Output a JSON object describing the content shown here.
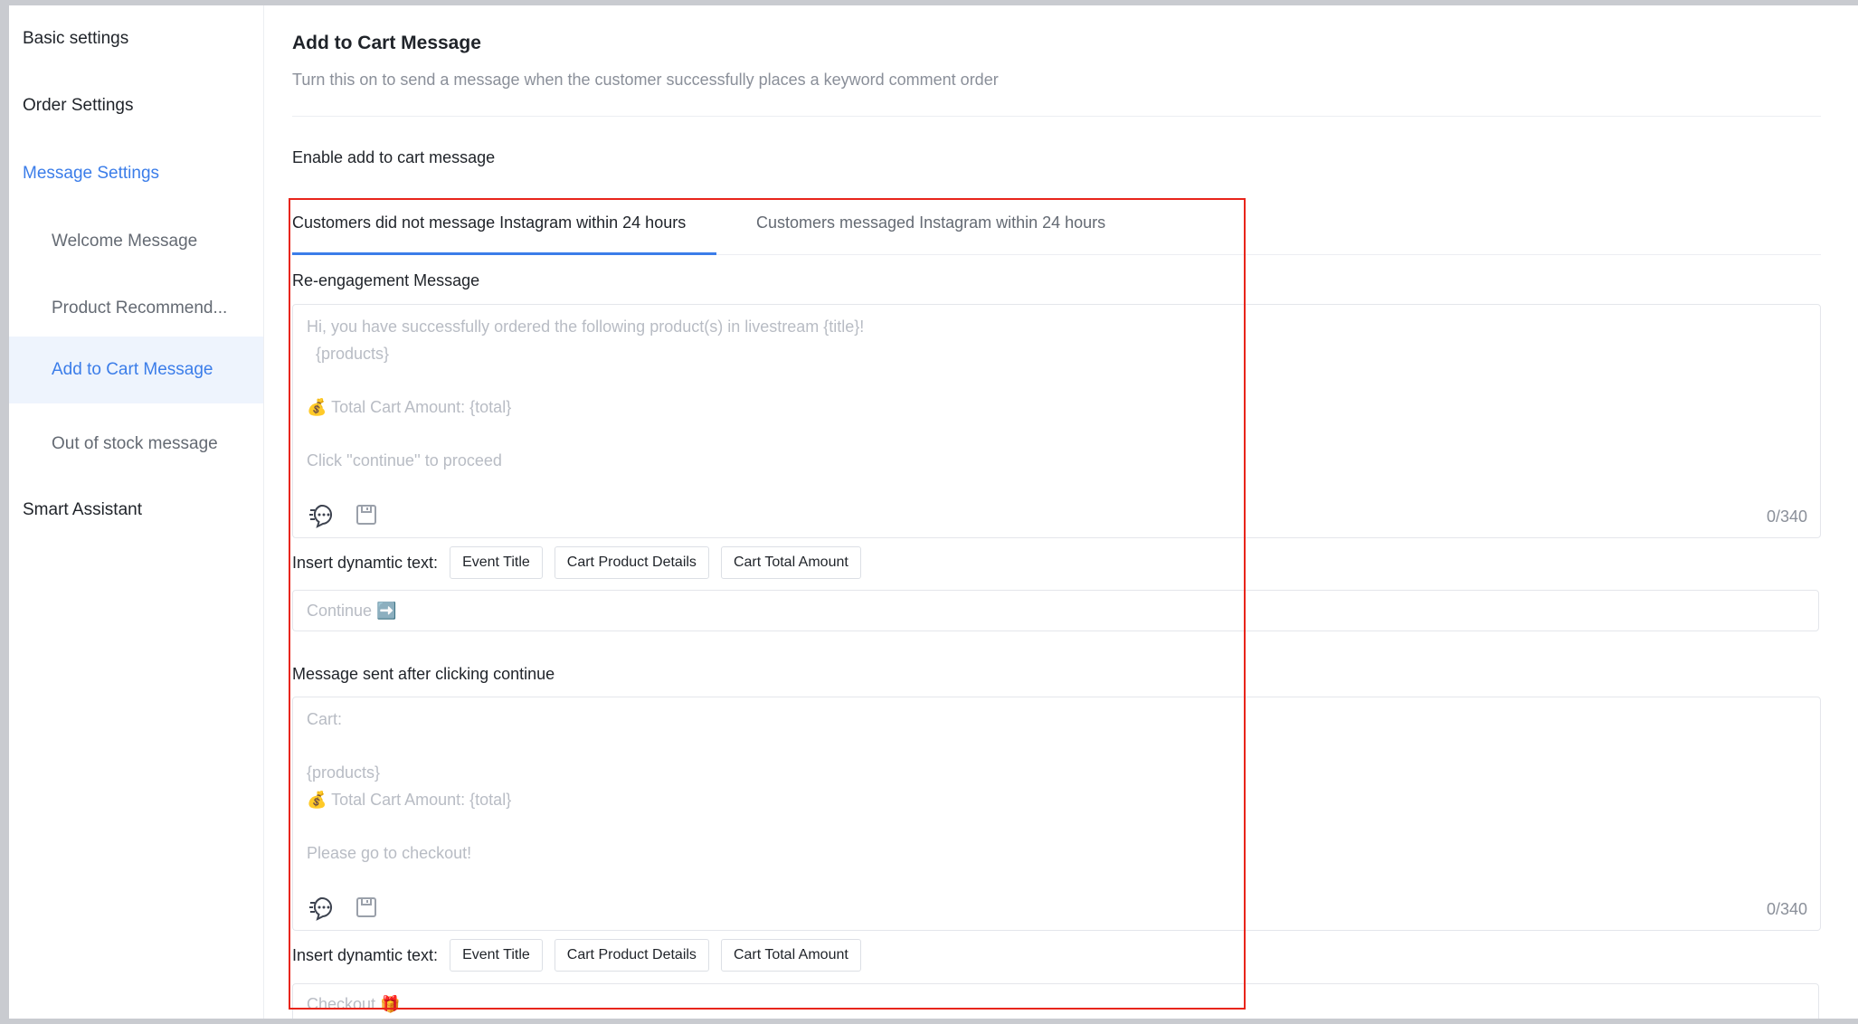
{
  "sidebar": {
    "items": [
      {
        "label": "Basic settings"
      },
      {
        "label": "Order Settings"
      },
      {
        "label": "Message Settings"
      },
      {
        "label": "Welcome Message"
      },
      {
        "label": "Product Recommend..."
      },
      {
        "label": "Add to Cart Message"
      },
      {
        "label": "Out of stock message"
      },
      {
        "label": "Smart Assistant"
      }
    ]
  },
  "main": {
    "title": "Add to Cart Message",
    "description": "Turn this on to send a message when the customer successfully places a keyword comment order",
    "enable_label": "Enable add to cart message",
    "tabs": [
      {
        "label": "Customers did not message Instagram within 24 hours"
      },
      {
        "label": "Customers messaged Instagram within 24 hours"
      }
    ],
    "reengagement": {
      "label": "Re-engagement Message",
      "placeholder": "Hi, you have successfully ordered the following product(s) in livestream {title}!\n  {products}\n\n💰 Total Cart Amount: {total}\n\nClick ''continue'' to proceed",
      "counter": "0/340",
      "insert_label": "Insert dynamtic text:",
      "chips": [
        "Event Title",
        "Cart Product Details",
        "Cart Total Amount"
      ],
      "button_placeholder": "Continue ➡️"
    },
    "after_continue": {
      "label": "Message sent after clicking continue",
      "placeholder": "Cart:\n\n{products}\n💰 Total Cart Amount: {total}\n\nPlease go to checkout!",
      "counter": "0/340",
      "insert_label": "Insert dynamtic text:",
      "chips": [
        "Event Title",
        "Cart Product Details",
        "Cart Total Amount"
      ],
      "button_placeholder": "Checkout 🎁"
    }
  },
  "icons": {
    "quick_reply": "quick-reply-icon",
    "save": "save-icon"
  },
  "colors": {
    "accent": "#3b7de9",
    "highlight_border": "#e8251b",
    "placeholder": "#b8bcc4"
  }
}
